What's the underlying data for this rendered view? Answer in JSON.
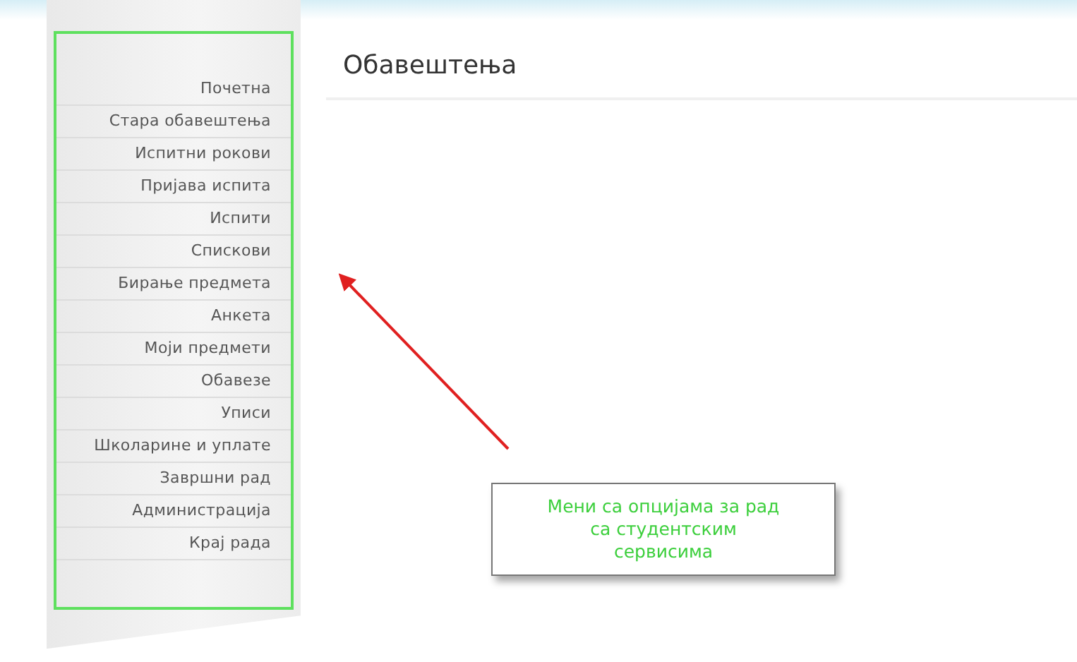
{
  "sidebar": {
    "items": [
      {
        "label": "Почетна"
      },
      {
        "label": "Стара обавештења"
      },
      {
        "label": "Испитни рокови"
      },
      {
        "label": "Пријава испита"
      },
      {
        "label": "Испити"
      },
      {
        "label": "Спискови"
      },
      {
        "label": "Бирање предмета"
      },
      {
        "label": "Анкета"
      },
      {
        "label": "Моји предмети"
      },
      {
        "label": "Обавезе"
      },
      {
        "label": "Уписи"
      },
      {
        "label": "Школарине и уплате"
      },
      {
        "label": "Завршни рад"
      },
      {
        "label": "Администрација"
      },
      {
        "label": "Крај рада"
      }
    ]
  },
  "page": {
    "title": "Обавештења"
  },
  "callout": {
    "text": "Мени са опцијама за рад са студентским сервисима"
  }
}
